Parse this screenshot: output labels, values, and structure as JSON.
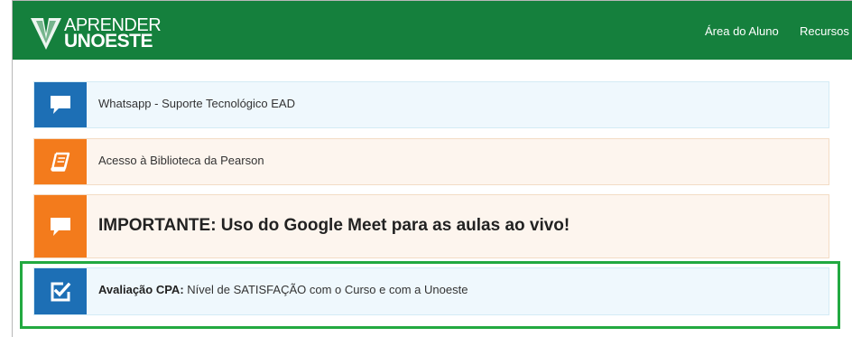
{
  "header": {
    "logo_line1": "APRENDER",
    "logo_line2": "UNOESTE",
    "nav": [
      "Área do Aluno",
      "Recursos Gl"
    ],
    "background_color": "#15803d"
  },
  "notices": [
    {
      "icon": "chat-bubble-icon",
      "text": "Whatsapp - Suporte Tecnológico EAD",
      "color": "#1d6fb5"
    },
    {
      "icon": "book-icon",
      "text": "Acesso à Biblioteca da Pearson",
      "color": "#f37b1c"
    },
    {
      "icon": "chat-bubble-icon",
      "text": "IMPORTANTE: Uso do Google Meet para as aulas ao vivo!",
      "color": "#f37b1c"
    },
    {
      "icon": "checkbox-icon",
      "bold_prefix": "Avaliação CPA:",
      "text": " Nível de SATISFAÇÃO com o Curso e com a Unoeste",
      "color": "#1d6fb5"
    }
  ],
  "highlight_color": "#22a940"
}
